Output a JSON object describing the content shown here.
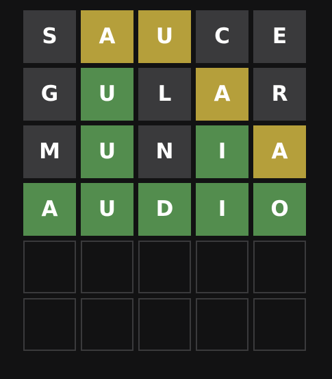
{
  "colors": {
    "background": "#121213",
    "absent": "#3a3a3c",
    "present": "#b59f3b",
    "correct": "#538d4e",
    "empty_border": "#3a3a3c"
  },
  "board": {
    "rows": [
      {
        "tiles": [
          {
            "letter": "S",
            "state": "absent"
          },
          {
            "letter": "A",
            "state": "present"
          },
          {
            "letter": "U",
            "state": "present"
          },
          {
            "letter": "C",
            "state": "absent"
          },
          {
            "letter": "E",
            "state": "absent"
          }
        ]
      },
      {
        "tiles": [
          {
            "letter": "G",
            "state": "absent"
          },
          {
            "letter": "U",
            "state": "correct"
          },
          {
            "letter": "L",
            "state": "absent"
          },
          {
            "letter": "A",
            "state": "present"
          },
          {
            "letter": "R",
            "state": "absent"
          }
        ]
      },
      {
        "tiles": [
          {
            "letter": "M",
            "state": "absent"
          },
          {
            "letter": "U",
            "state": "correct"
          },
          {
            "letter": "N",
            "state": "absent"
          },
          {
            "letter": "I",
            "state": "correct"
          },
          {
            "letter": "A",
            "state": "present"
          }
        ]
      },
      {
        "tiles": [
          {
            "letter": "A",
            "state": "correct"
          },
          {
            "letter": "U",
            "state": "correct"
          },
          {
            "letter": "D",
            "state": "correct"
          },
          {
            "letter": "I",
            "state": "correct"
          },
          {
            "letter": "O",
            "state": "correct"
          }
        ]
      },
      {
        "tiles": [
          {
            "letter": "",
            "state": "empty"
          },
          {
            "letter": "",
            "state": "empty"
          },
          {
            "letter": "",
            "state": "empty"
          },
          {
            "letter": "",
            "state": "empty"
          },
          {
            "letter": "",
            "state": "empty"
          }
        ]
      },
      {
        "tiles": [
          {
            "letter": "",
            "state": "empty"
          },
          {
            "letter": "",
            "state": "empty"
          },
          {
            "letter": "",
            "state": "empty"
          },
          {
            "letter": "",
            "state": "empty"
          },
          {
            "letter": "",
            "state": "empty"
          }
        ]
      }
    ]
  }
}
